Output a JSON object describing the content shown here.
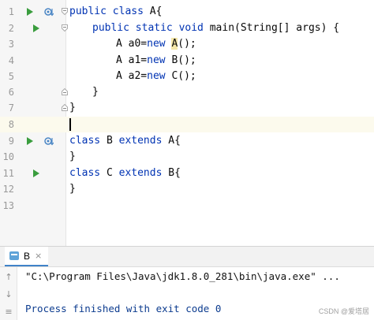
{
  "editor": {
    "line_numbers": [
      "1",
      "2",
      "3",
      "4",
      "5",
      "6",
      "7",
      "8",
      "9",
      "10",
      "11",
      "12",
      "13"
    ],
    "tokens": {
      "l1_kw": "public class ",
      "l1_plain": "A{",
      "l2_kw": "public static void ",
      "l2_plain": "main(String[] args) {",
      "l3_pre": "A a0=",
      "l3_kw": "new ",
      "l3_A": "A",
      "l3_post": "();",
      "l4_pre": "A a1=",
      "l4_kw": "new ",
      "l4_post": "B();",
      "l5_pre": "A a2=",
      "l5_kw": "new ",
      "l5_post": "C();",
      "l6": "}",
      "l7": "}",
      "l9_kw1": "class ",
      "l9_mid": "B ",
      "l9_kw2": "extends ",
      "l9_post": "A{",
      "l10": "}",
      "l11_kw1": "class ",
      "l11_mid": "C ",
      "l11_kw2": "extends ",
      "l11_post": "B{",
      "l12": "}"
    }
  },
  "icons": {
    "run": "run-gutter-icon",
    "override": "implemented-override-icon",
    "fold": "fold-marker-icon",
    "up": "arrow-up-icon",
    "down": "arrow-down-icon",
    "wrap": "soft-wrap-icon",
    "tab": "run-config-icon",
    "close": "close-icon"
  },
  "run_window": {
    "tab_label": "B",
    "close_glyph": "×",
    "toolbar_up": "↑",
    "toolbar_down": "↓",
    "toolbar_wrap": "≡",
    "command": "\"C:\\Program Files\\Java\\jdk1.8.0_281\\bin\\java.exe\" ...",
    "exit_message": "Process finished with exit code 0"
  },
  "watermark": "CSDN @爱塔居",
  "colors": {
    "keyword": "#0033b3",
    "text": "#080808",
    "run_green": "#3a9d3e",
    "current_line": "#fcfaed",
    "highlight": "#f5e7a8",
    "console_blue": "#0d3c8f"
  }
}
